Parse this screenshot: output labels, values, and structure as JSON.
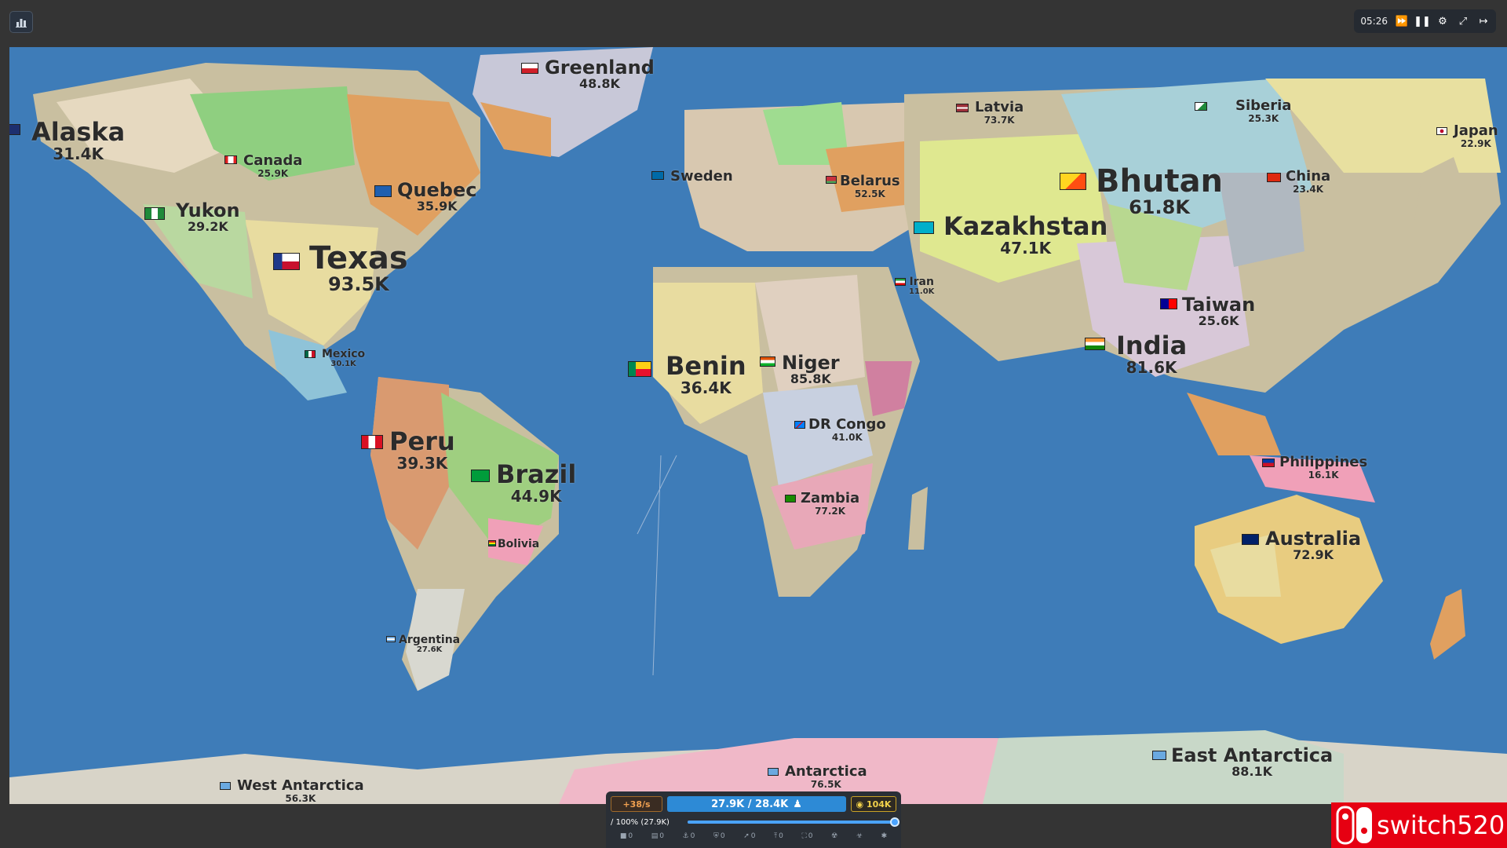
{
  "top_bar": {
    "stats_button_icon": "bar-chart-icon",
    "timer": "05:26",
    "controls": [
      "fast-forward-icon",
      "pause-icon",
      "gear-icon",
      "fullscreen-icon",
      "exit-icon"
    ]
  },
  "map": {
    "ocean_color": "#3e7cb8",
    "territories": [
      {
        "name": "Alaska",
        "population": "31.4K",
        "size": "l",
        "flag_colors": [
          "#1d2f6f"
        ]
      },
      {
        "name": "Canada",
        "population": "25.9K",
        "size": "s",
        "flag_colors": [
          "#e02020",
          "#ffffff"
        ]
      },
      {
        "name": "Greenland",
        "population": "48.8K",
        "size": "m",
        "flag_colors": [
          "#ffffff",
          "#d0202a"
        ]
      },
      {
        "name": "Quebec",
        "population": "35.9K",
        "size": "m",
        "flag_colors": [
          "#1f5fb0",
          "#ffffff"
        ]
      },
      {
        "name": "Yukon",
        "population": "29.2K",
        "size": "m",
        "flag_colors": [
          "#1f8a3a",
          "#ffffff"
        ]
      },
      {
        "name": "Texas",
        "population": "93.5K",
        "size": "xl",
        "flag_colors": [
          "#1f3a8a",
          "#ffffff",
          "#c8102e"
        ]
      },
      {
        "name": "Mexico",
        "population": "30.1K",
        "size": "xs",
        "flag_colors": [
          "#006847",
          "#ffffff",
          "#ce1126"
        ]
      },
      {
        "name": "Peru",
        "population": "39.3K",
        "size": "l",
        "flag_colors": [
          "#d91023",
          "#ffffff"
        ]
      },
      {
        "name": "Brazil",
        "population": "44.9K",
        "size": "l",
        "flag_colors": [
          "#009c3b",
          "#ffdf00"
        ]
      },
      {
        "name": "Bolivia",
        "population": "",
        "size": "xs",
        "flag_colors": [
          "#d52b1e",
          "#f9e300",
          "#007934"
        ]
      },
      {
        "name": "Argentina",
        "population": "27.6K",
        "size": "xs",
        "flag_colors": [
          "#74acdf",
          "#ffffff"
        ]
      },
      {
        "name": "West Antarctica",
        "population": "56.3K",
        "size": "s",
        "flag_colors": [
          "#6aa9e0",
          "#ffffff"
        ]
      },
      {
        "name": "Sweden",
        "population": "",
        "size": "s",
        "flag_colors": [
          "#006aa7",
          "#fecc00"
        ]
      },
      {
        "name": "Latvia",
        "population": "73.7K",
        "size": "s",
        "flag_colors": [
          "#9e3039",
          "#ffffff"
        ]
      },
      {
        "name": "Belarus",
        "population": "52.5K",
        "size": "s",
        "flag_colors": [
          "#c8313e",
          "#4aa657"
        ]
      },
      {
        "name": "Siberia",
        "population": "25.3K",
        "size": "s",
        "flag_colors": [
          "#ffffff",
          "#1f8a3a"
        ]
      },
      {
        "name": "Japan",
        "population": "22.9K",
        "size": "s",
        "flag_colors": [
          "#ffffff",
          "#bc002d"
        ]
      },
      {
        "name": "Bhutan",
        "population": "61.8K",
        "size": "xl",
        "flag_colors": [
          "#ffd520",
          "#ff4e12"
        ]
      },
      {
        "name": "China",
        "population": "23.4K",
        "size": "s",
        "flag_colors": [
          "#de2910",
          "#ffde00"
        ]
      },
      {
        "name": "Kazakhstan",
        "population": "47.1K",
        "size": "l",
        "flag_colors": [
          "#00afca",
          "#fec50c"
        ]
      },
      {
        "name": "Iran",
        "population": "11.0K",
        "size": "xs",
        "flag_colors": [
          "#239f40",
          "#ffffff",
          "#da0000"
        ]
      },
      {
        "name": "Taiwan",
        "population": "25.6K",
        "size": "m",
        "flag_colors": [
          "#fe0000",
          "#000095"
        ]
      },
      {
        "name": "India",
        "population": "81.6K",
        "size": "l",
        "flag_colors": [
          "#ff9933",
          "#ffffff",
          "#138808"
        ]
      },
      {
        "name": "Benin",
        "population": "36.4K",
        "size": "l",
        "flag_colors": [
          "#008751",
          "#fcd116",
          "#e8112d"
        ]
      },
      {
        "name": "Niger",
        "population": "85.8K",
        "size": "m",
        "flag_colors": [
          "#e05206",
          "#ffffff",
          "#0db02b"
        ]
      },
      {
        "name": "DR Congo",
        "population": "41.0K",
        "size": "s",
        "flag_colors": [
          "#007fff",
          "#ce1021"
        ]
      },
      {
        "name": "Zambia",
        "population": "77.2K",
        "size": "s",
        "flag_colors": [
          "#198a00",
          "#de2010"
        ]
      },
      {
        "name": "Philippines",
        "population": "16.1K",
        "size": "s",
        "flag_colors": [
          "#0038a8",
          "#ce1126"
        ]
      },
      {
        "name": "Australia",
        "population": "72.9K",
        "size": "m",
        "flag_colors": [
          "#012169",
          "#ffffff"
        ]
      },
      {
        "name": "Antarctica",
        "population": "76.5K",
        "size": "s",
        "flag_colors": [
          "#6aa9e0",
          "#ffffff"
        ]
      },
      {
        "name": "East Antarctica",
        "population": "88.1K",
        "size": "m",
        "flag_colors": [
          "#6aa9e0",
          "#ffffff"
        ]
      }
    ]
  },
  "hud": {
    "income": "+38/s",
    "troops": "27.9K / 28.4K",
    "gold": "104K",
    "attack_ratio": "100% (27.9K)",
    "attack_ratio_fraction": 1.0,
    "buildings": [
      {
        "icon": "city-icon",
        "count": "0"
      },
      {
        "icon": "factory-icon",
        "count": "0"
      },
      {
        "icon": "port-icon",
        "count": "0"
      },
      {
        "icon": "defense-post-icon",
        "count": "0"
      },
      {
        "icon": "missile-silo-icon",
        "count": "0"
      },
      {
        "icon": "sam-launcher-icon",
        "count": "0"
      },
      {
        "icon": "warship-icon",
        "count": "0"
      },
      {
        "icon": "nuke-icon",
        "count": ""
      },
      {
        "icon": "hydrogen-bomb-icon",
        "count": ""
      },
      {
        "icon": "mirv-icon",
        "count": ""
      }
    ]
  },
  "watermark": {
    "logo": "switch-logo-icon",
    "text": "switch520",
    "color": "#e60012"
  }
}
